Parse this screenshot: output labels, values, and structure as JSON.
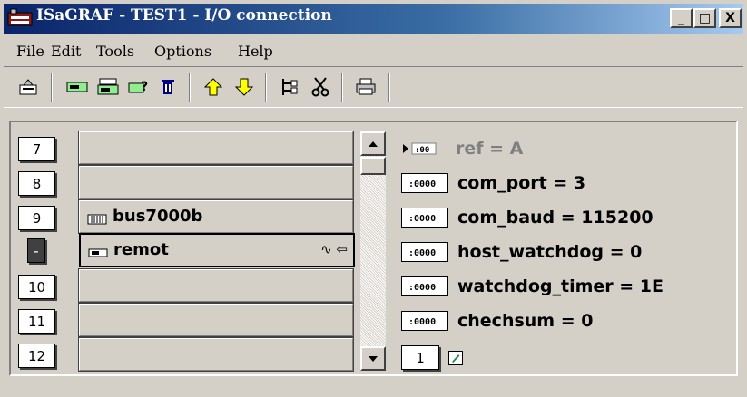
{
  "window": {
    "title": "ISaGRAF - TEST1 - I/O connection",
    "controls": {
      "minimize": "_",
      "maximize": "□",
      "close": "X"
    }
  },
  "menu": [
    {
      "label": "File",
      "icon": null
    },
    {
      "label": "Edit",
      "icon": null
    },
    {
      "label": "Tools",
      "icon": null
    },
    {
      "label": "Options",
      "icon": null
    },
    {
      "label": "Help",
      "icon": null
    }
  ],
  "toolbar": {
    "icons": [
      "save-icon",
      "board-icon",
      "board-stack-icon",
      "board-help-icon",
      "delete-icon",
      "up-arrow-icon",
      "down-arrow-icon",
      "tree-icon",
      "cut-icon",
      "print-icon"
    ]
  },
  "slots": [
    {
      "number": "7",
      "label": "",
      "icon": null,
      "extra": ""
    },
    {
      "number": "8",
      "label": "",
      "icon": null,
      "extra": ""
    },
    {
      "number": "9",
      "label": "bus7000b",
      "icon": "rack-icon",
      "extra": ""
    },
    {
      "number": "-",
      "label": "remot",
      "icon": "board-icon",
      "extra": "∿ ⇦"
    },
    {
      "number": "10",
      "label": "",
      "icon": null,
      "extra": ""
    },
    {
      "number": "11",
      "label": "",
      "icon": null,
      "extra": ""
    },
    {
      "number": "12",
      "label": "",
      "icon": null,
      "extra": ""
    }
  ],
  "params": [
    {
      "text": "ref = A",
      "grayed": true
    },
    {
      "text": "com_port = 3",
      "grayed": false
    },
    {
      "text": "com_baud = 115200",
      "grayed": false
    },
    {
      "text": "host_watchdog = 0",
      "grayed": false
    },
    {
      "text": "watchdog_timer = 1E",
      "grayed": false
    },
    {
      "text": "chechsum = 0",
      "grayed": false
    }
  ],
  "channel": {
    "number": "1"
  },
  "colors": {
    "title_start": "#0a246a",
    "title_end": "#a6caf0",
    "face": "#d4d0c8"
  }
}
